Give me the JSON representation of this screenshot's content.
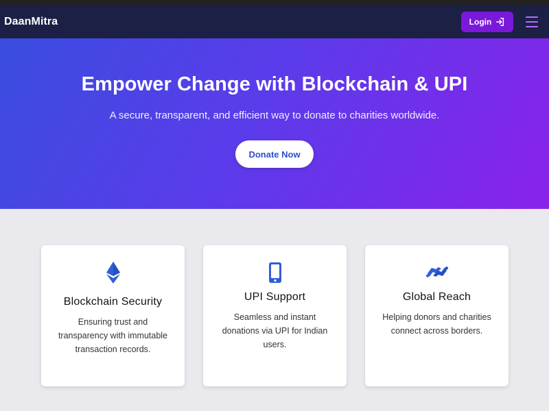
{
  "nav": {
    "brand": "DaanMitra",
    "login_label": "Login",
    "login_icon": "login-arrow-icon",
    "menu_icon": "hamburger-menu-icon"
  },
  "hero": {
    "title": "Empower Change with Blockchain & UPI",
    "subtitle": "A secure, transparent, and efficient way to donate to charities worldwide.",
    "cta_label": "Donate Now"
  },
  "features": [
    {
      "icon": "ethereum-icon",
      "title": "Blockchain Security",
      "text": "Ensuring trust and transparency with immutable transaction records."
    },
    {
      "icon": "mobile-phone-icon",
      "title": "UPI Support",
      "text": "Seamless and instant donations via UPI for Indian users."
    },
    {
      "icon": "handshake-icon",
      "title": "Global Reach",
      "text": "Helping donors and charities connect across borders."
    }
  ],
  "colors": {
    "navbar": "#1c2045",
    "accent": "#7a19d9",
    "hero_gradient_start": "#3a4de0",
    "hero_gradient_end": "#8a22ea",
    "icon_blue": "#2f5fd6"
  }
}
